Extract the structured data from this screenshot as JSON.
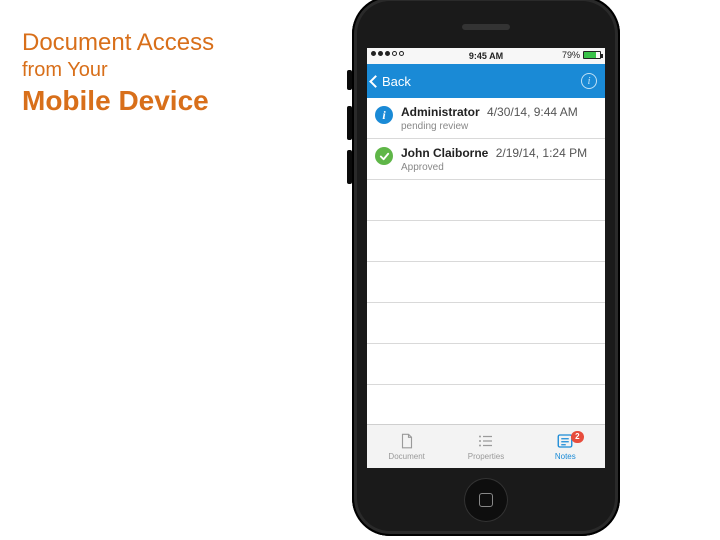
{
  "slide": {
    "line1": "Document Access",
    "line2": "from Your",
    "line3": "Mobile Device"
  },
  "statusbar": {
    "time": "9:45 AM",
    "battery_pct": "79%"
  },
  "navbar": {
    "back_label": "Back"
  },
  "rows": [
    {
      "name": "Administrator",
      "date": "4/30/14, 9:44 AM",
      "status": "pending review"
    },
    {
      "name": "John Claiborne",
      "date": "2/19/14, 1:24 PM",
      "status": "Approved"
    }
  ],
  "tabs": {
    "document": "Document",
    "properties": "Properties",
    "notes": "Notes",
    "notes_badge": "2"
  }
}
